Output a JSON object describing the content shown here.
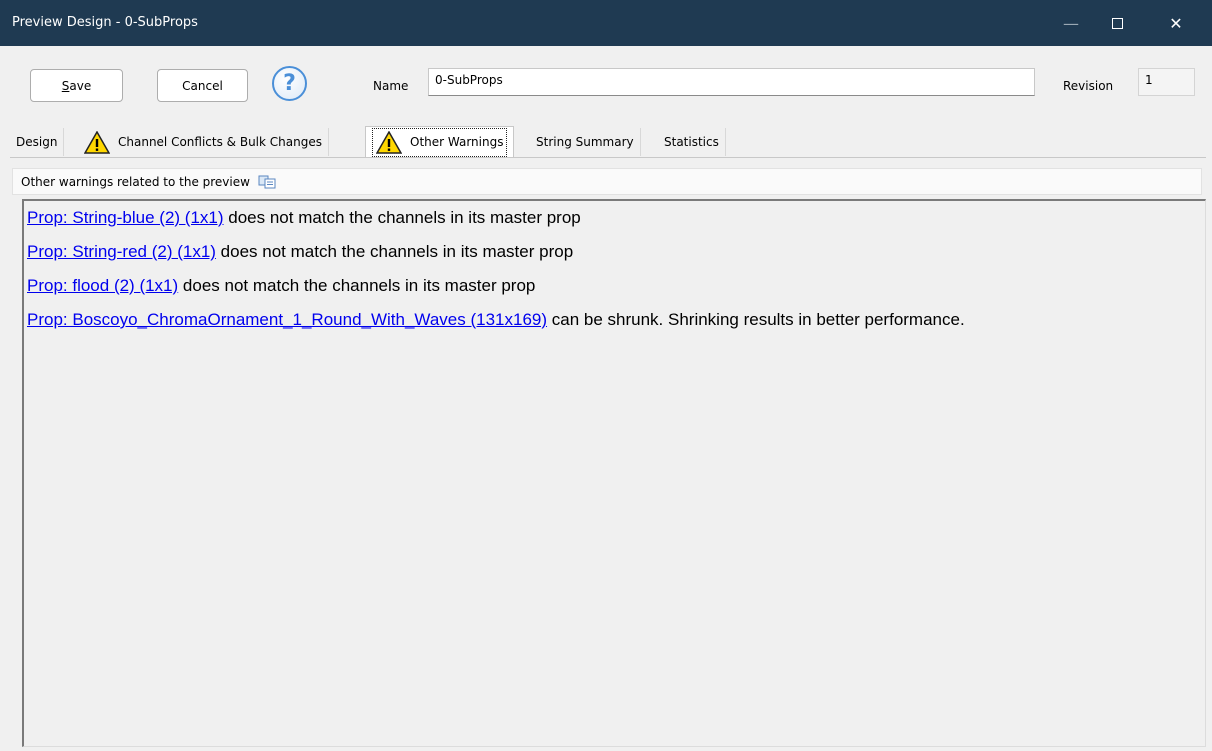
{
  "window": {
    "title": "Preview Design - 0-SubProps",
    "minimize_glyph": "—",
    "close_glyph": "✕"
  },
  "toolbar": {
    "save_label": "Save",
    "cancel_label": "Cancel",
    "help_glyph": "?",
    "name_label": "Name",
    "name_value": "0-SubProps",
    "revision_label": "Revision",
    "revision_value": "1"
  },
  "tabs": [
    {
      "label": "Design",
      "warning": false,
      "active": false
    },
    {
      "label": "Channel Conflicts & Bulk Changes",
      "warning": true,
      "active": false
    },
    {
      "label": "Other Warnings",
      "warning": true,
      "active": true
    },
    {
      "label": "String Summary",
      "warning": false,
      "active": false
    },
    {
      "label": "Statistics",
      "warning": false,
      "active": false
    }
  ],
  "panel": {
    "info_text": "Other warnings related to the preview",
    "copy_icon": "copy-icon"
  },
  "warnings": [
    {
      "link": "Prop: String-blue (2) (1x1)",
      "text": " does not match the channels in its master prop"
    },
    {
      "link": "Prop: String-red (2) (1x1)",
      "text": " does not match the channels in its master prop"
    },
    {
      "link": "Prop: flood (2) (1x1)",
      "text": " does not match the channels in its master prop"
    },
    {
      "link": "Prop: Boscoyo_ChromaOrnament_1_Round_With_Waves (131x169)",
      "text": " can be shrunk. Shrinking results in better performance."
    }
  ],
  "colors": {
    "titlebar": "#1f3a52",
    "link": "#0000ee",
    "warning_yellow": "#ffd700"
  }
}
